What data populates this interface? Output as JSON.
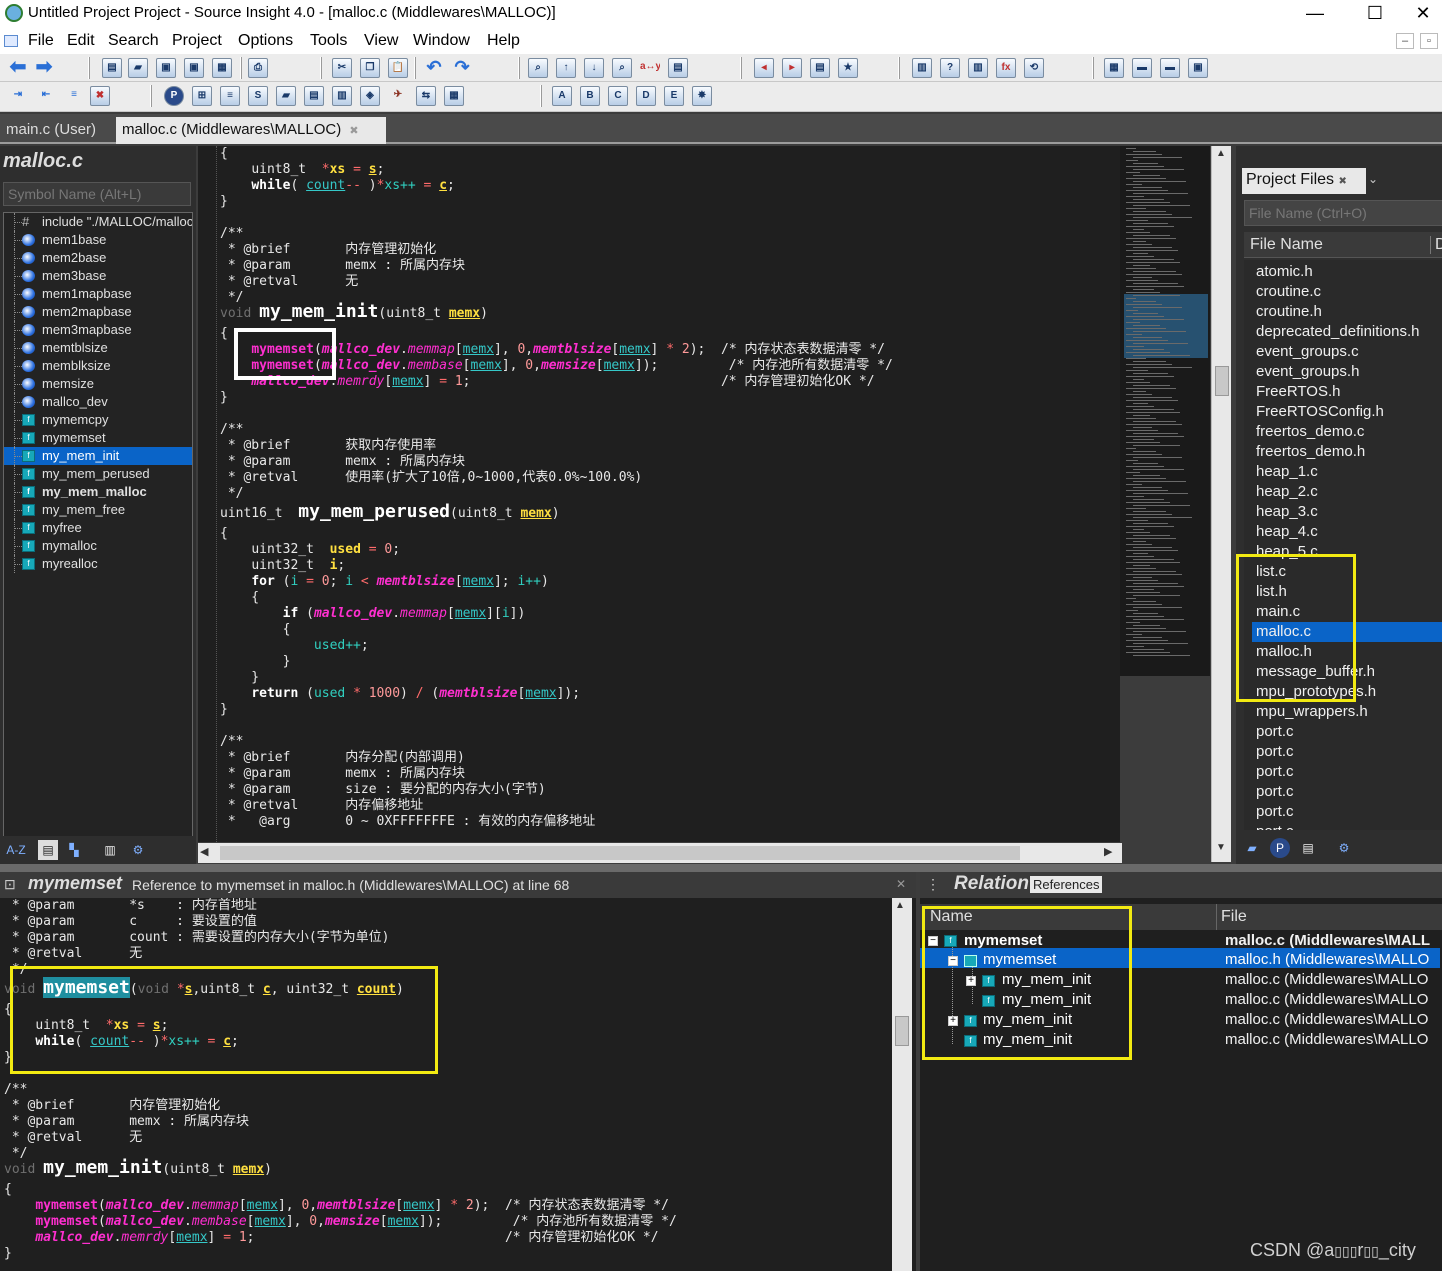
{
  "window": {
    "title": "Untitled Project Project - Source Insight 4.0 - [malloc.c (Middlewares\\MALLOC)]",
    "minimize": "—",
    "maximize": "☐",
    "close": "✕"
  },
  "menu": [
    "File",
    "Edit",
    "Search",
    "Project",
    "Options",
    "Tools",
    "View",
    "Window",
    "Help"
  ],
  "tabs": [
    {
      "label": "main.c (User)"
    },
    {
      "label": "malloc.c (Middlewares\\MALLOC)",
      "close": "✖"
    }
  ],
  "symbols": {
    "title": "malloc.c",
    "search_placeholder": "Symbol Name (Alt+L)",
    "items": [
      {
        "label": "include \"./MALLOC/malloc.h\"",
        "type": "include"
      },
      {
        "label": "mem1base",
        "type": "var"
      },
      {
        "label": "mem2base",
        "type": "var"
      },
      {
        "label": "mem3base",
        "type": "var"
      },
      {
        "label": "mem1mapbase",
        "type": "var"
      },
      {
        "label": "mem2mapbase",
        "type": "var"
      },
      {
        "label": "mem3mapbase",
        "type": "var"
      },
      {
        "label": "memtblsize",
        "type": "var"
      },
      {
        "label": "memblksize",
        "type": "var"
      },
      {
        "label": "memsize",
        "type": "var"
      },
      {
        "label": "mallco_dev",
        "type": "var"
      },
      {
        "label": "mymemcpy",
        "type": "fn"
      },
      {
        "label": "mymemset",
        "type": "fn"
      },
      {
        "label": "my_mem_init",
        "type": "fn",
        "selected": true
      },
      {
        "label": "my_mem_perused",
        "type": "fn"
      },
      {
        "label": "my_mem_malloc",
        "type": "fn",
        "bold": true
      },
      {
        "label": "my_mem_free",
        "type": "fn"
      },
      {
        "label": "myfree",
        "type": "fn"
      },
      {
        "label": "mymalloc",
        "type": "fn"
      },
      {
        "label": "myrealloc",
        "type": "fn"
      }
    ]
  },
  "project": {
    "tab": "Project Files",
    "tab_close": "✖",
    "search_placeholder": "File Name (Ctrl+O)",
    "column": "File Name",
    "column2": "D",
    "files": [
      "atomic.h",
      "croutine.c",
      "croutine.h",
      "deprecated_definitions.h",
      "event_groups.c",
      "event_groups.h",
      "FreeRTOS.h",
      "FreeRTOSConfig.h",
      "freertos_demo.c",
      "freertos_demo.h",
      "heap_1.c",
      "heap_2.c",
      "heap_3.c",
      "heap_4.c",
      "heap_5.c",
      "list.c",
      "list.h",
      "main.c",
      "malloc.c",
      "malloc.h",
      "message_buffer.h",
      "mpu_prototypes.h",
      "mpu_wrappers.h",
      "port.c",
      "port.c",
      "port.c",
      "port.c",
      "port.c",
      "port.c"
    ],
    "selected": "malloc.c"
  },
  "context": {
    "symbol": "mymemset",
    "description": "Reference to mymemset in malloc.h (Middlewares\\MALLOC) at line 68",
    "close": "✕"
  },
  "relation": {
    "title": "Relation",
    "subtitle": "References",
    "col_name": "Name",
    "col_file": "File",
    "rows": [
      {
        "name": "mymemset",
        "file": "malloc.c (Middlewares\\MALL",
        "selected": false
      },
      {
        "name": "mymemset",
        "file": "malloc.h (Middlewares\\MALLO",
        "selected": true
      },
      {
        "name": "my_mem_init",
        "file": "malloc.c (Middlewares\\MALLO",
        "selected": false
      },
      {
        "name": "my_mem_init",
        "file": "malloc.c (Middlewares\\MALLO",
        "selected": false
      },
      {
        "name": "my_mem_init",
        "file": "malloc.c (Middlewares\\MALLO",
        "selected": false
      },
      {
        "name": "my_mem_init",
        "file": "malloc.c (Middlewares\\MALLO",
        "selected": false
      }
    ]
  },
  "watermark": "CSDN @a\u0000\u0000\u0000r\u0000\u0000_city",
  "colors": {
    "selection": "#0a64c8",
    "highlight_box": "#f2ea12",
    "editor_bg": "#1f1f1f",
    "function_call": "#ff2fd0",
    "parameter": "#ffe040"
  }
}
